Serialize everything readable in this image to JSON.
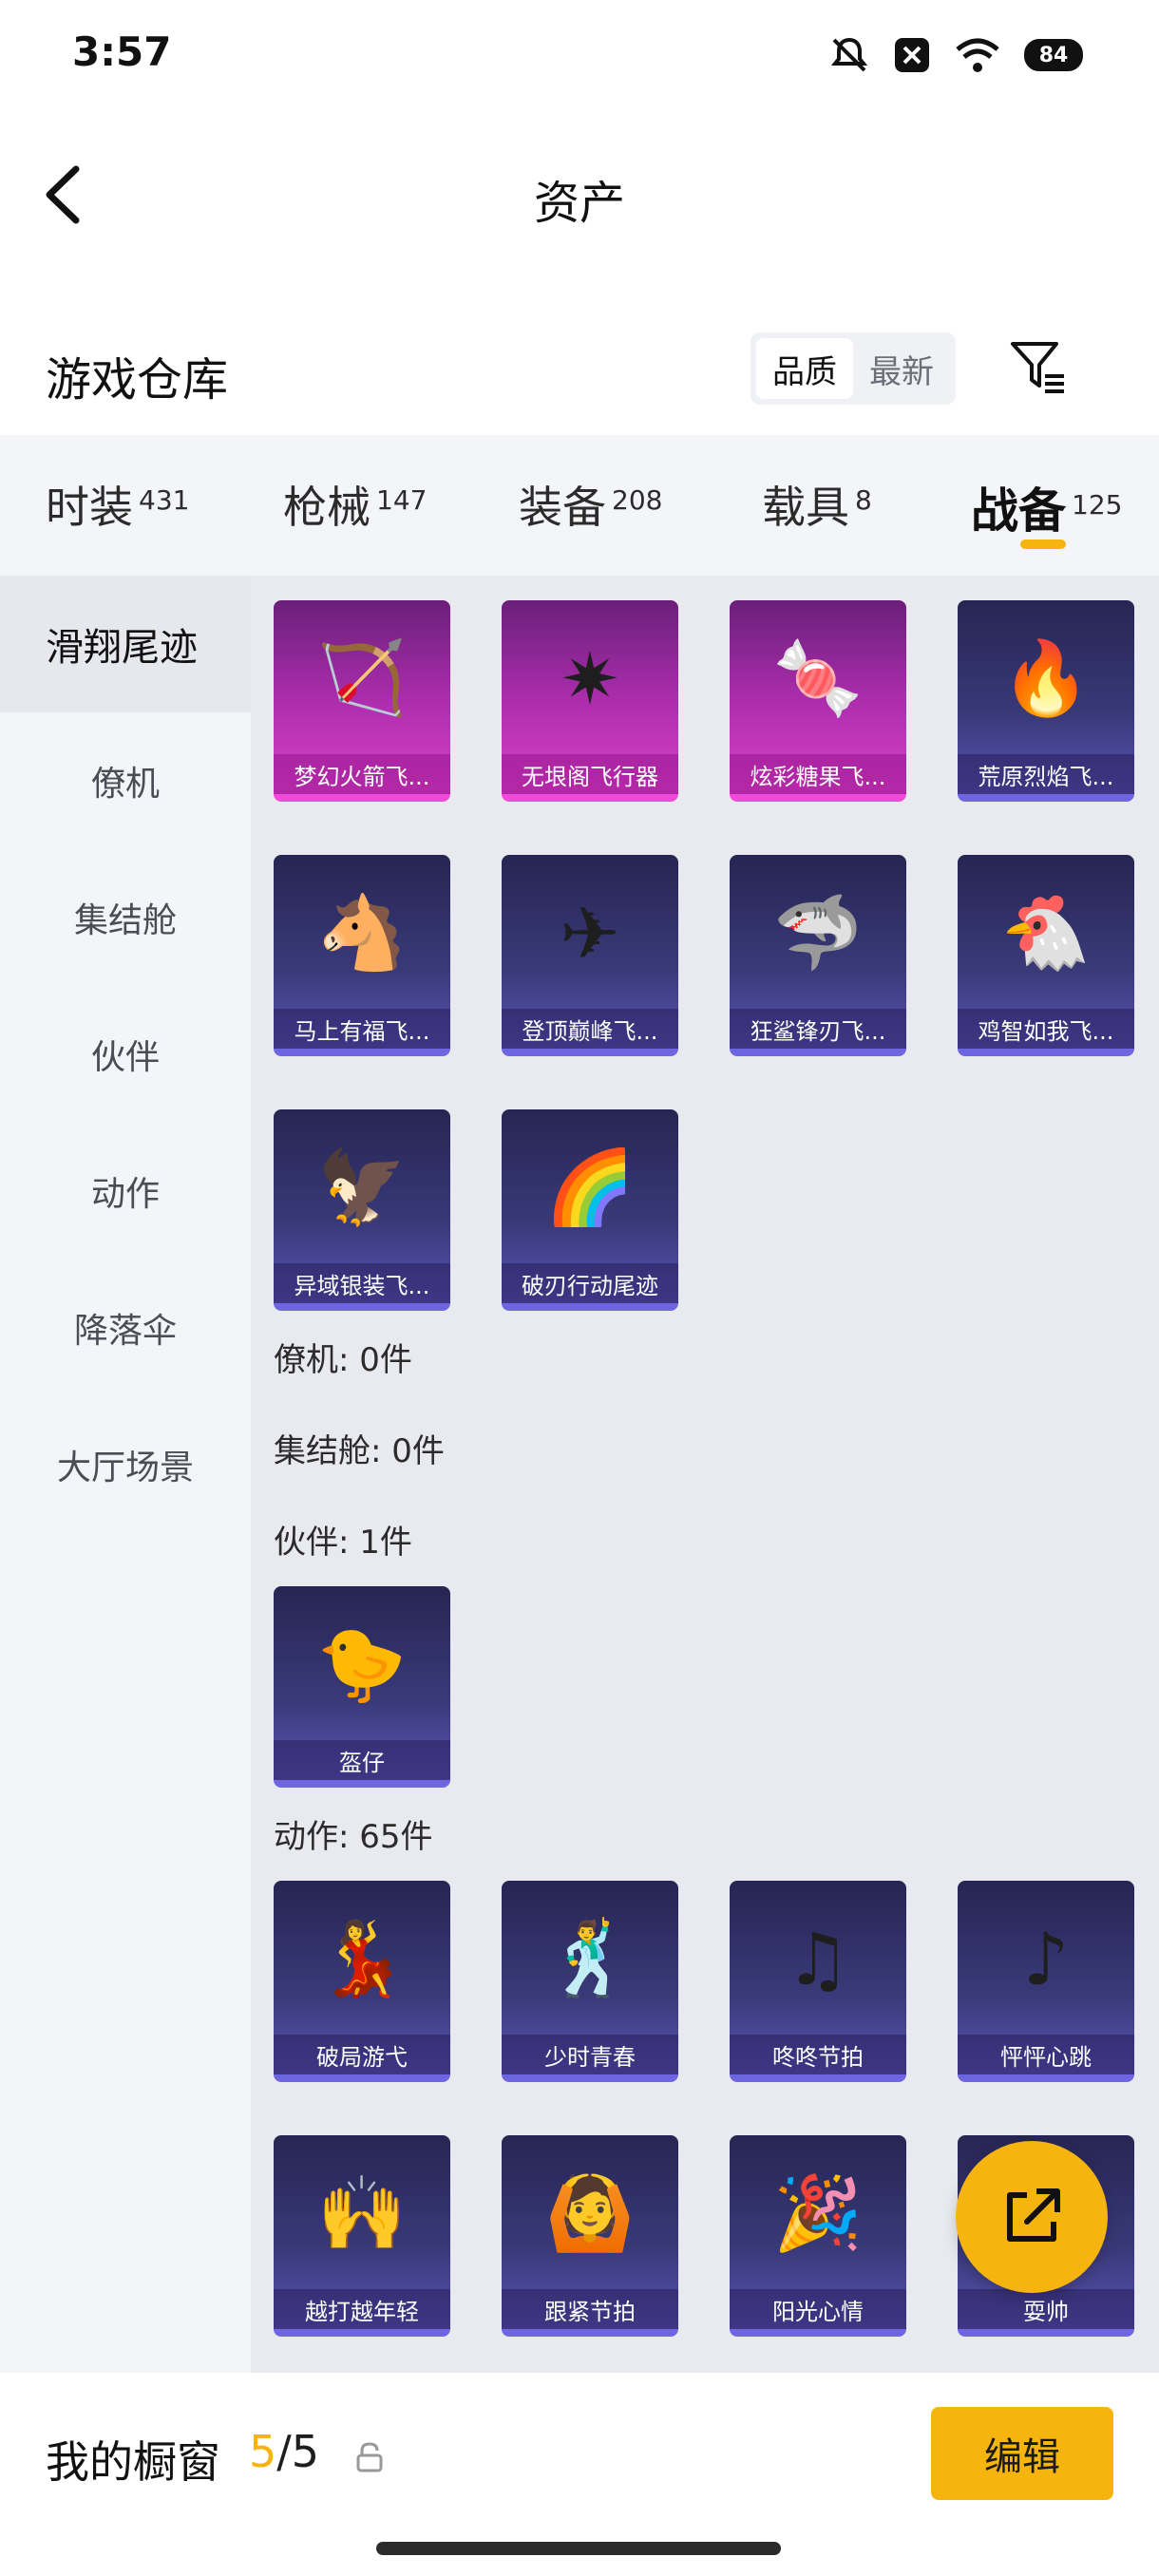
{
  "status_bar": {
    "time": "3:57",
    "battery": "84",
    "icons": [
      "mute-icon",
      "close-notification-icon",
      "wifi-icon",
      "battery-icon"
    ]
  },
  "header": {
    "title": "资产",
    "back_icon": "chevron-left-icon"
  },
  "warehouse": {
    "title": "游戏仓库",
    "sort_options": [
      "品质",
      "最新"
    ],
    "active_sort": "品质",
    "filter_icon": "filter-icon"
  },
  "tabs": [
    {
      "label": "时装",
      "count": "431"
    },
    {
      "label": "枪械",
      "count": "147"
    },
    {
      "label": "装备",
      "count": "208"
    },
    {
      "label": "载具",
      "count": "8"
    },
    {
      "label": "战备",
      "count": "125",
      "active": true
    }
  ],
  "sidebar": [
    "滑翔尾迹",
    "僚机",
    "集结舱",
    "伙伴",
    "动作",
    "降落伞",
    "大厅场景"
  ],
  "glide_items": [
    "梦幻火箭飞...",
    "无垠阁飞行器",
    "炫彩糖果飞...",
    "荒原烈焰飞...",
    "马上有福飞...",
    "登顶巅峰飞...",
    "狂鲨锋刃飞...",
    "鸡智如我飞...",
    "异域银装飞...",
    "破刃行动尾迹"
  ],
  "groups": {
    "wingman": "僚机: 0件",
    "rally": "集结舱: 0件",
    "partner": "伙伴: 1件",
    "emote": "动作: 65件"
  },
  "partner_items": [
    "盔仔"
  ],
  "emote_items": [
    "破局游弋",
    "少时青春",
    "咚咚节拍",
    "怦怦心跳",
    "越打越年轻",
    "跟紧节拍",
    "阳光心情",
    "耍帅"
  ],
  "bottom": {
    "showcase_label": "我的橱窗",
    "showcase_current": "5",
    "showcase_total": "/5",
    "edit_label": "编辑"
  },
  "colors": {
    "accent": "#f6b40e",
    "card_purple": "#3a3a7a",
    "card_pink": "#b02eb0"
  }
}
